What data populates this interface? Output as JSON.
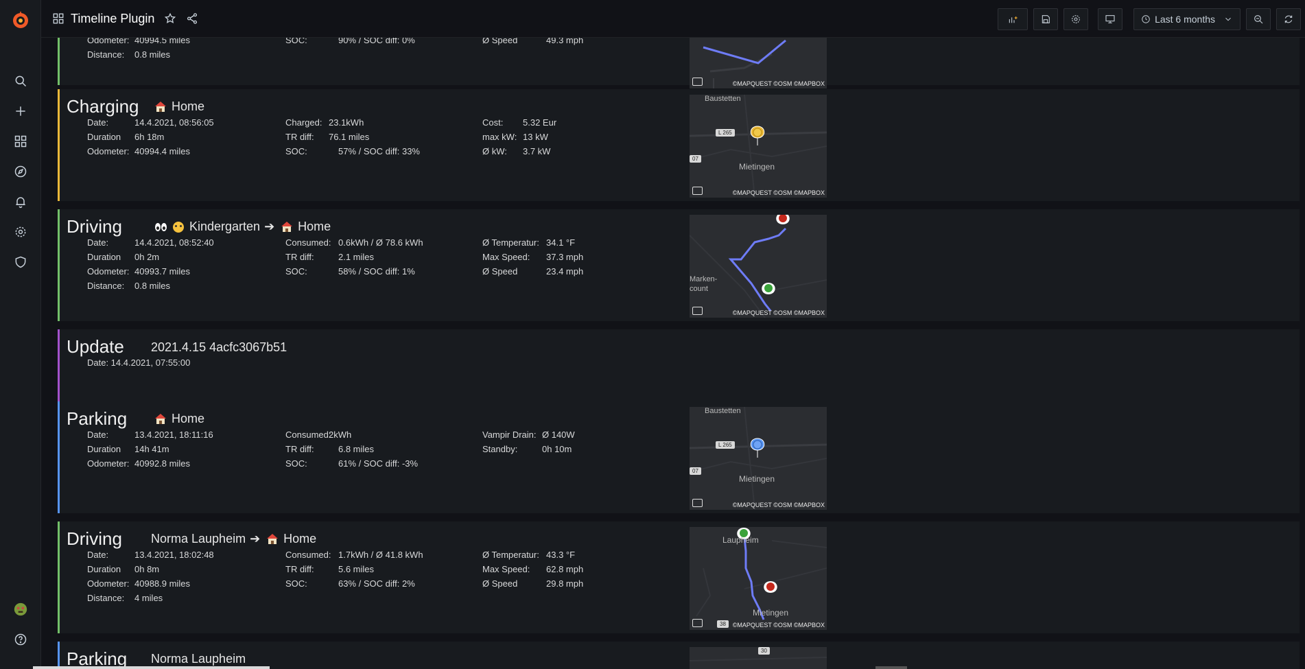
{
  "topbar": {
    "title": "Timeline Plugin",
    "time_range": "Last 6 months"
  },
  "panels": {
    "top_partial": {
      "odometer_label": "Odometer:",
      "odometer": "40994.5 miles",
      "distance_label": "Distance:",
      "distance": "0.8 miles",
      "soc_label": "SOC:",
      "soc": "90% / SOC diff: 0%",
      "speed_label": "Ø Speed",
      "speed": "49.3 mph"
    },
    "charging": {
      "type": "Charging",
      "dest": "Home",
      "date_label": "Date:",
      "date": "14.4.2021, 08:56:05",
      "duration_label": "Duration",
      "duration": "6h 18m",
      "odometer_label": "Odometer:",
      "odometer": "40994.4 miles",
      "charged_label": "Charged:",
      "charged": "23.1kWh",
      "trdiff_label": "TR diff:",
      "trdiff": "76.1 miles",
      "soc_label": "SOC:",
      "soc": "57% / SOC diff: 33%",
      "cost_label": "Cost:",
      "cost": "5.32 Eur",
      "maxkw_label": "max kW:",
      "maxkw": "13 kW",
      "avgkw_label": "Ø kW:",
      "avgkw": "3.7 kW"
    },
    "driving1": {
      "type": "Driving",
      "from": "Kindergarten",
      "to": "Home",
      "date_label": "Date:",
      "date": "14.4.2021, 08:52:40",
      "duration_label": "Duration",
      "duration": "0h 2m",
      "odometer_label": "Odometer:",
      "odometer": "40993.7 miles",
      "distance_label": "Distance:",
      "distance": "0.8 miles",
      "consumed_label": "Consumed:",
      "consumed": "0.6kWh / Ø 78.6 kWh",
      "trdiff_label": "TR diff:",
      "trdiff": "2.1 miles",
      "soc_label": "SOC:",
      "soc": "58% / SOC diff: 1%",
      "temp_label": "Ø Temperatur:",
      "temp": "34.1 °F",
      "maxspeed_label": "Max Speed:",
      "maxspeed": "37.3 mph",
      "speed_label": "Ø Speed",
      "speed": "23.4 mph"
    },
    "update": {
      "type": "Update",
      "version": "2021.4.15 4acfc3067b51",
      "date_line": "Date: 14.4.2021, 07:55:00"
    },
    "parking1": {
      "type": "Parking",
      "dest": "Home",
      "date_label": "Date:",
      "date": "13.4.2021, 18:11:16",
      "duration_label": "Duration",
      "duration": "14h 41m",
      "odometer_label": "Odometer:",
      "odometer": "40992.8 miles",
      "consumed_label": "Consumed:",
      "consumed": "2kWh",
      "trdiff_label": "TR diff:",
      "trdiff": "6.8 miles",
      "soc_label": "SOC:",
      "soc": "61% / SOC diff: -3%",
      "vampir_label": "Vampir Drain:",
      "vampir": "Ø 140W",
      "standby_label": "Standby:",
      "standby": "0h 10m"
    },
    "driving2": {
      "type": "Driving",
      "from": "Norma Laupheim",
      "to": "Home",
      "date_label": "Date:",
      "date": "13.4.2021, 18:02:48",
      "duration_label": "Duration",
      "duration": "0h 8m",
      "odometer_label": "Odometer:",
      "odometer": "40988.9 miles",
      "distance_label": "Distance:",
      "distance": "4 miles",
      "consumed_label": "Consumed:",
      "consumed": "1.7kWh / Ø 41.8 kWh",
      "trdiff_label": "TR diff:",
      "trdiff": "5.6 miles",
      "soc_label": "SOC:",
      "soc": "63% / SOC diff: 2%",
      "temp_label": "Ø Temperatur:",
      "temp": "43.3 °F",
      "maxspeed_label": "Max Speed:",
      "maxspeed": "62.8 mph",
      "speed_label": "Ø Speed",
      "speed": "29.8 mph"
    },
    "parking2": {
      "type": "Parking",
      "dest": "Norma Laupheim"
    }
  },
  "map": {
    "attribution": "©MAPQUEST ©OSM ©MAPBOX",
    "town_mietingen": "Mietingen",
    "town_baustetten": "Baustetten",
    "town_laupheim": "Laupheim",
    "town_marken": "Marken-",
    "town_count": "count",
    "road_l265": "L 265",
    "road_07": "07",
    "road_30": "30",
    "road_38": "38"
  },
  "colors": {
    "driving": "#73bf69",
    "charging": "#eab839",
    "update": "#a352cc",
    "parking": "#5794f2",
    "route": "#6e7cf7"
  }
}
